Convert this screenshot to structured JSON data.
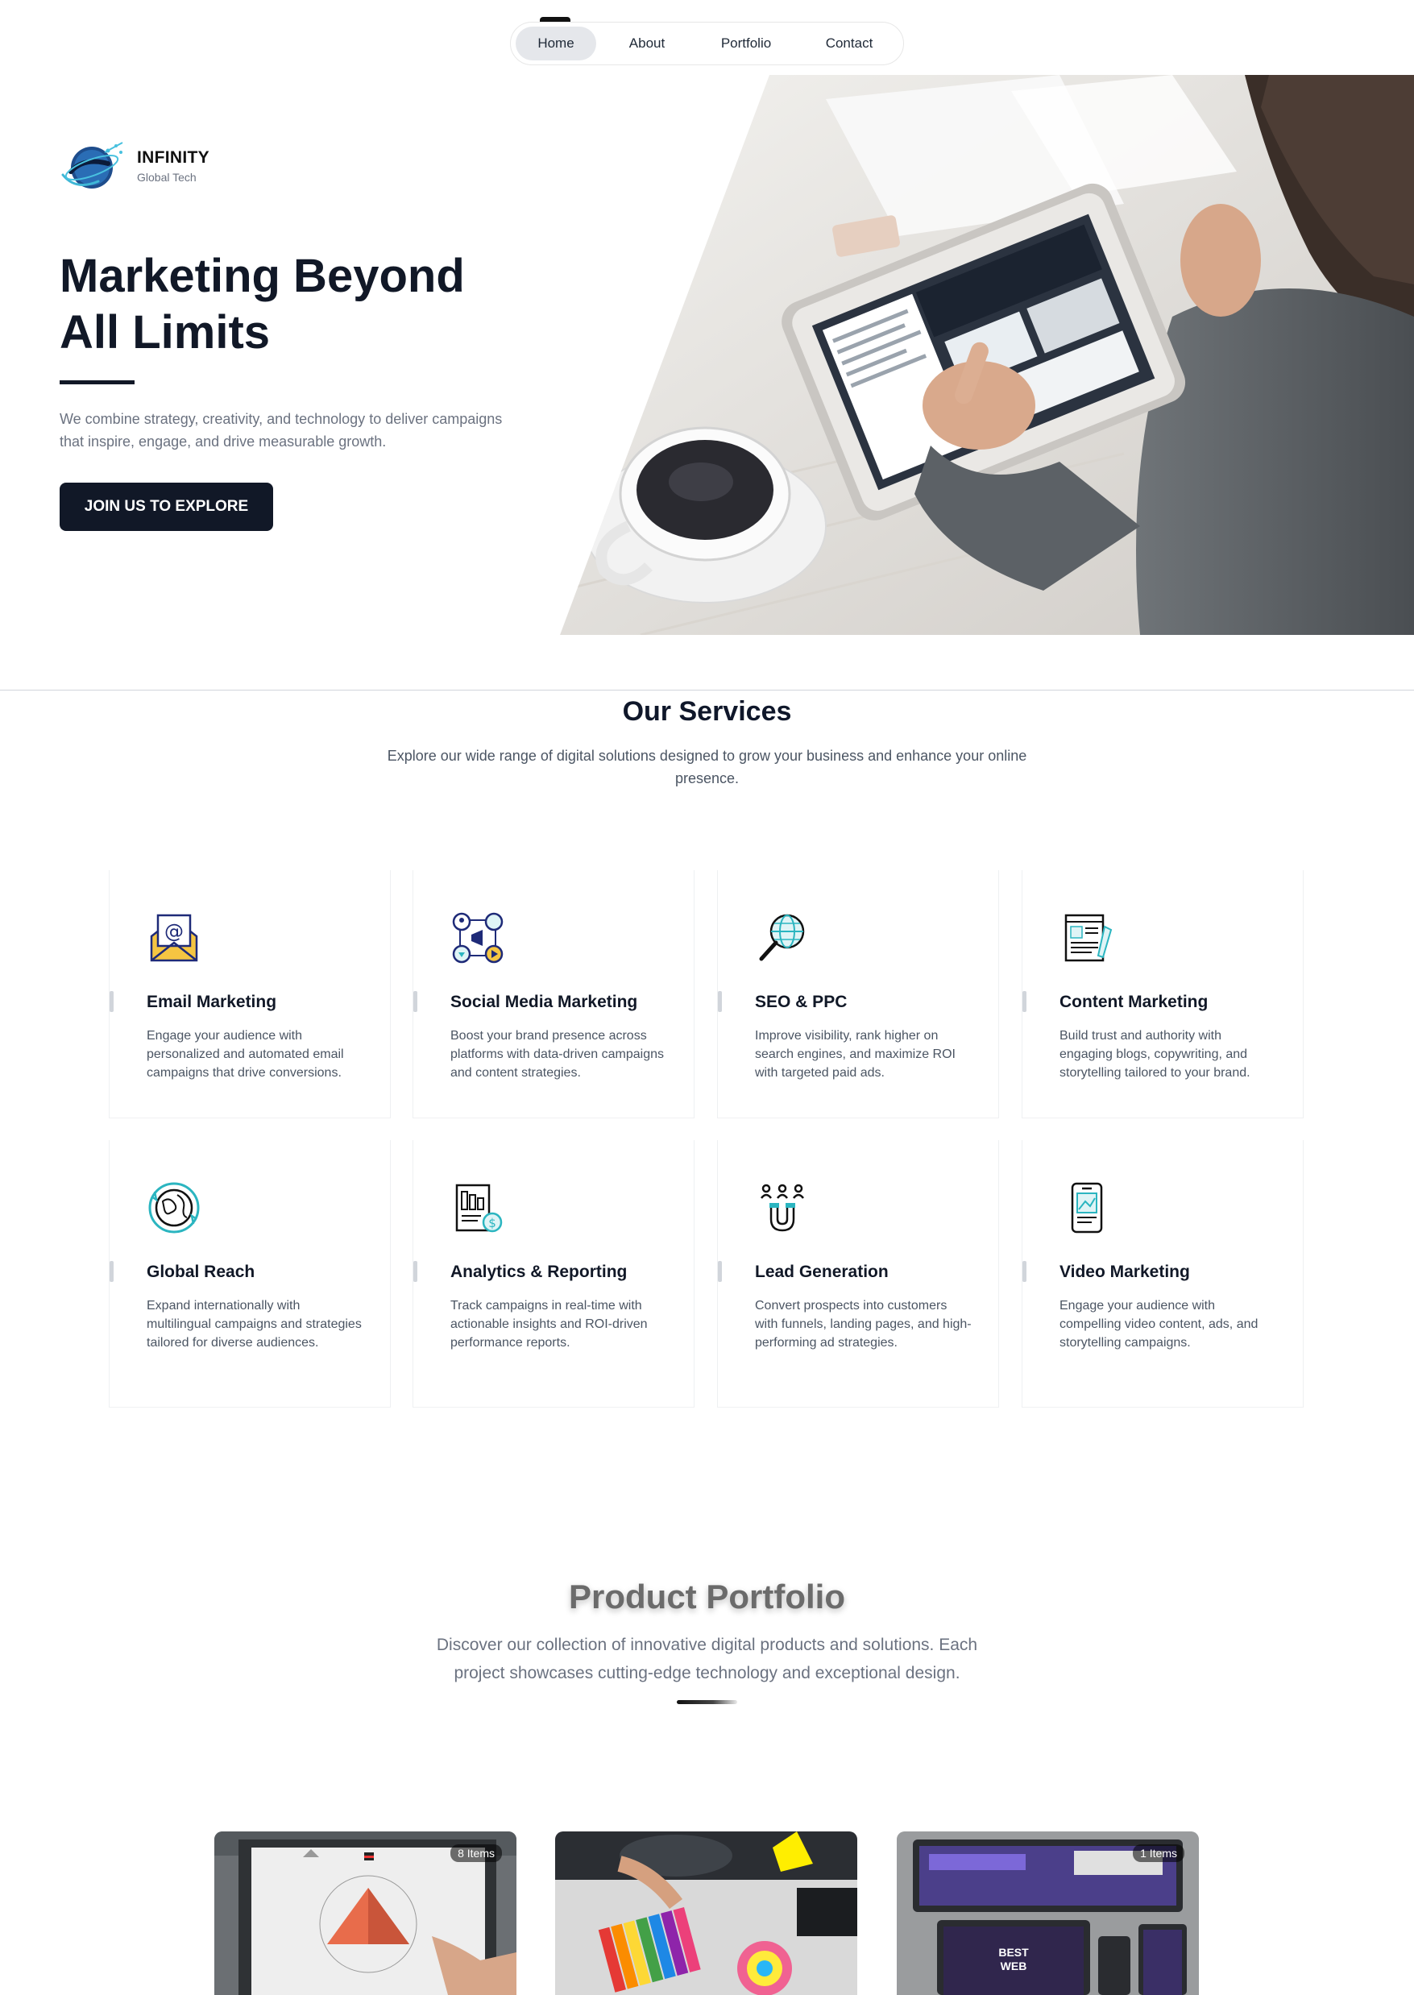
{
  "nav": {
    "items": [
      {
        "label": "Home",
        "active": true
      },
      {
        "label": "About",
        "active": false
      },
      {
        "label": "Portfolio",
        "active": false
      },
      {
        "label": "Contact",
        "active": false
      }
    ]
  },
  "brand": {
    "name": "INFINITY",
    "tagline": "Global Tech"
  },
  "hero": {
    "title_line1": "Marketing Beyond",
    "title_line2": "All Limits",
    "description": "We combine strategy, creativity, and technology to deliver campaigns that inspire, engage, and drive measurable growth.",
    "cta_label": "JOIN US TO EXPLORE"
  },
  "services": {
    "title": "Our Services",
    "subtitle": "Explore our wide range of digital solutions designed to grow your business and enhance your online presence.",
    "items": [
      {
        "title": "Email Marketing",
        "text": "Engage your audience with personalized and automated email campaigns that drive conversions.",
        "icon": "email-icon"
      },
      {
        "title": "Social Media Marketing",
        "text": "Boost your brand presence across platforms with data-driven campaigns and content strategies.",
        "icon": "social-media-icon"
      },
      {
        "title": "SEO & PPC",
        "text": "Improve visibility, rank higher on search engines, and maximize ROI with targeted paid ads.",
        "icon": "seo-search-icon"
      },
      {
        "title": "Content Marketing",
        "text": "Build trust and authority with engaging blogs, copywriting, and storytelling tailored to your brand.",
        "icon": "content-document-icon"
      },
      {
        "title": "Global Reach",
        "text": "Expand internationally with multilingual campaigns and strategies tailored for diverse audiences.",
        "icon": "globe-icon"
      },
      {
        "title": "Analytics & Reporting",
        "text": "Track campaigns in real-time with actionable insights and ROI-driven performance reports.",
        "icon": "analytics-report-icon"
      },
      {
        "title": "Lead Generation",
        "text": "Convert prospects into customers with funnels, landing pages, and high-performing ad strategies.",
        "icon": "magnet-leads-icon"
      },
      {
        "title": "Video Marketing",
        "text": "Engage your audience with compelling video content, ads, and storytelling campaigns.",
        "icon": "mobile-video-icon"
      }
    ]
  },
  "portfolio": {
    "title": "Product Portfolio",
    "subtitle": "Discover our collection of innovative digital products and solutions. Each project showcases cutting-edge technology and exceptional design.",
    "cards": [
      {
        "badge": "8 Items"
      },
      {
        "badge": ""
      },
      {
        "badge": "1 Items"
      }
    ]
  },
  "colors": {
    "primary_dark": "#111827",
    "accent_teal": "#2bb5c0",
    "accent_navy": "#1e2a78",
    "text_muted": "#6b7280"
  }
}
